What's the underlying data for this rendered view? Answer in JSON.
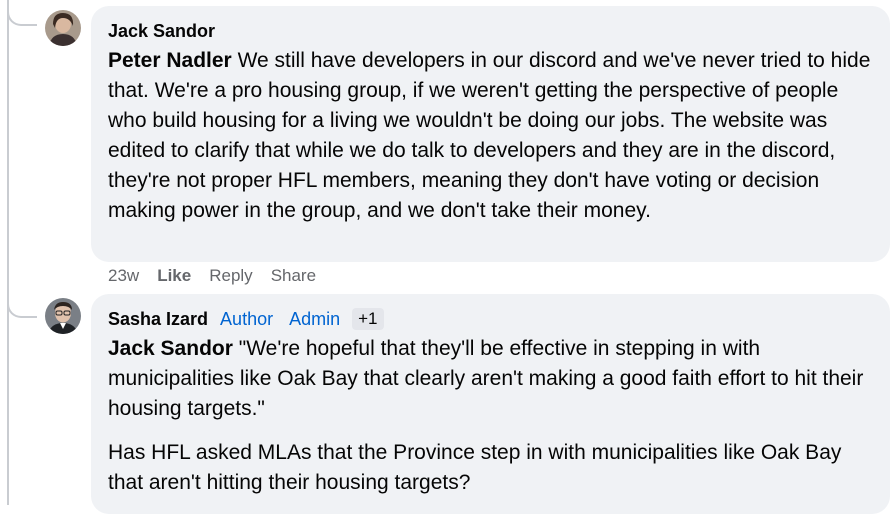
{
  "comments": [
    {
      "author": "Jack Sandor",
      "mention": "Peter Nadler",
      "text": " We still have developers in our discord and we've never tried to hide that. We're a pro housing group, if we weren't getting the perspective of people who build housing for a living we wouldn't be doing our jobs. The website was edited to clarify that while we do talk to developers and they are in the discord, they're not proper HFL members, meaning they don't have voting or decision making power in the group, and we don't take their money.",
      "actions": {
        "time": "23w",
        "like": "Like",
        "reply": "Reply",
        "share": "Share"
      }
    },
    {
      "author": "Sasha Izard",
      "badges": [
        "Author",
        "Admin"
      ],
      "extra_badge": "+1",
      "mention": "Jack Sandor",
      "text": " \"We're hopeful that they'll be effective in stepping in with municipalities like Oak Bay that clearly aren't making a good faith effort to hit their housing targets.\"",
      "text2": "Has HFL asked MLAs that the Province step in with municipalities like Oak Bay that aren't hitting their housing targets?"
    }
  ],
  "colors": {
    "bubble": "#f0f2f5",
    "badge": "#0064d1",
    "meta": "#65676b",
    "thread": "#c9ccd1"
  }
}
